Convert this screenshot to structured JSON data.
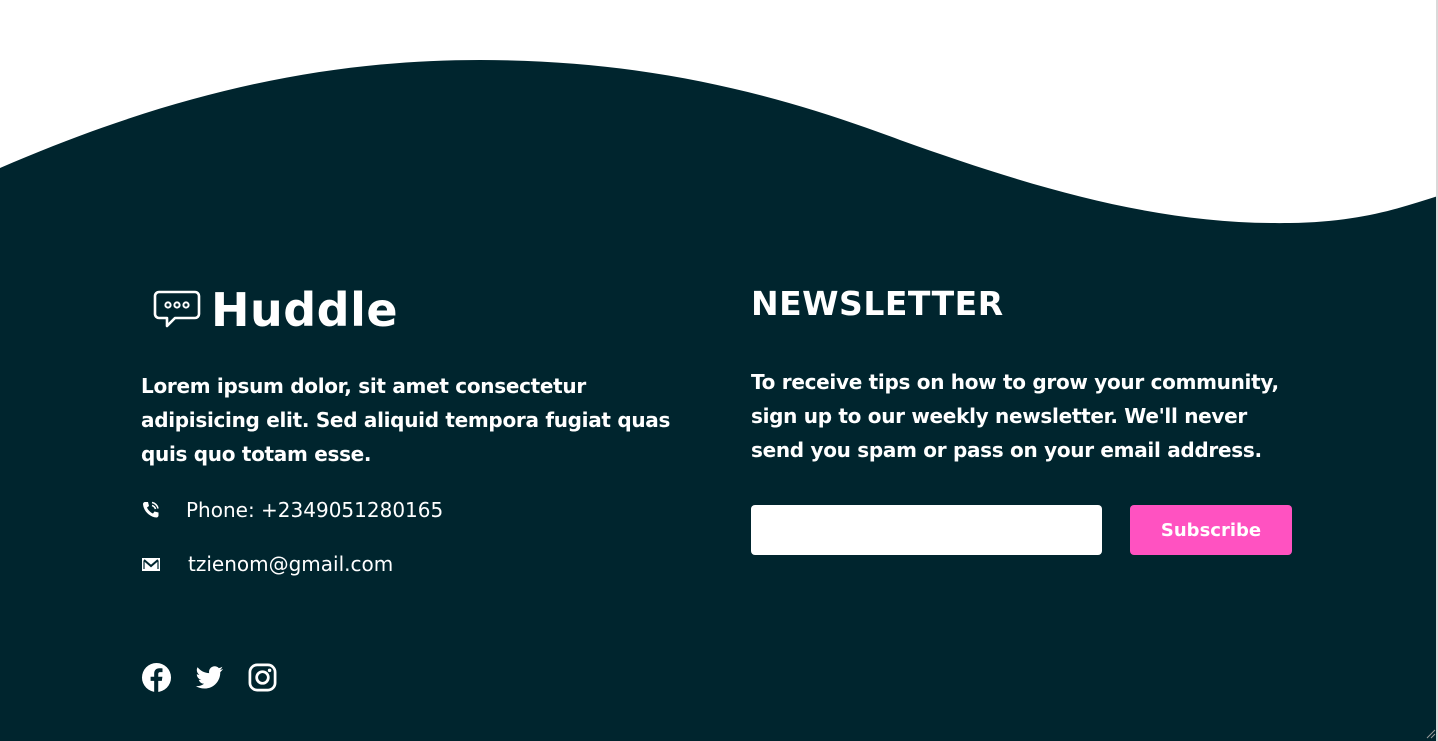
{
  "colors": {
    "footer_bg": "#00252e",
    "page_bg": "#ffffff",
    "accent": "#ff52c1",
    "text": "#ffffff"
  },
  "brand": {
    "name": "Huddle",
    "icon": "chat-bubble-icon"
  },
  "about": {
    "text": "Lorem ipsum dolor, sit amet consectetur adipisicing elit. Sed aliquid tempora fugiat quas quis quo totam esse."
  },
  "contact": {
    "phone": "Phone: +2349051280165",
    "phone_icon": "phone-icon",
    "email": "tzienom@gmail.com",
    "email_icon": "email-icon"
  },
  "social": [
    {
      "name": "facebook-icon"
    },
    {
      "name": "twitter-icon"
    },
    {
      "name": "instagram-icon"
    }
  ],
  "newsletter": {
    "title": "NEWSLETTER",
    "text": "To receive tips on how to grow your community, sign up to our weekly newsletter. We'll never send you spam or pass on your email address.",
    "input_value": "",
    "input_placeholder": "",
    "button_label": "Subscribe"
  }
}
